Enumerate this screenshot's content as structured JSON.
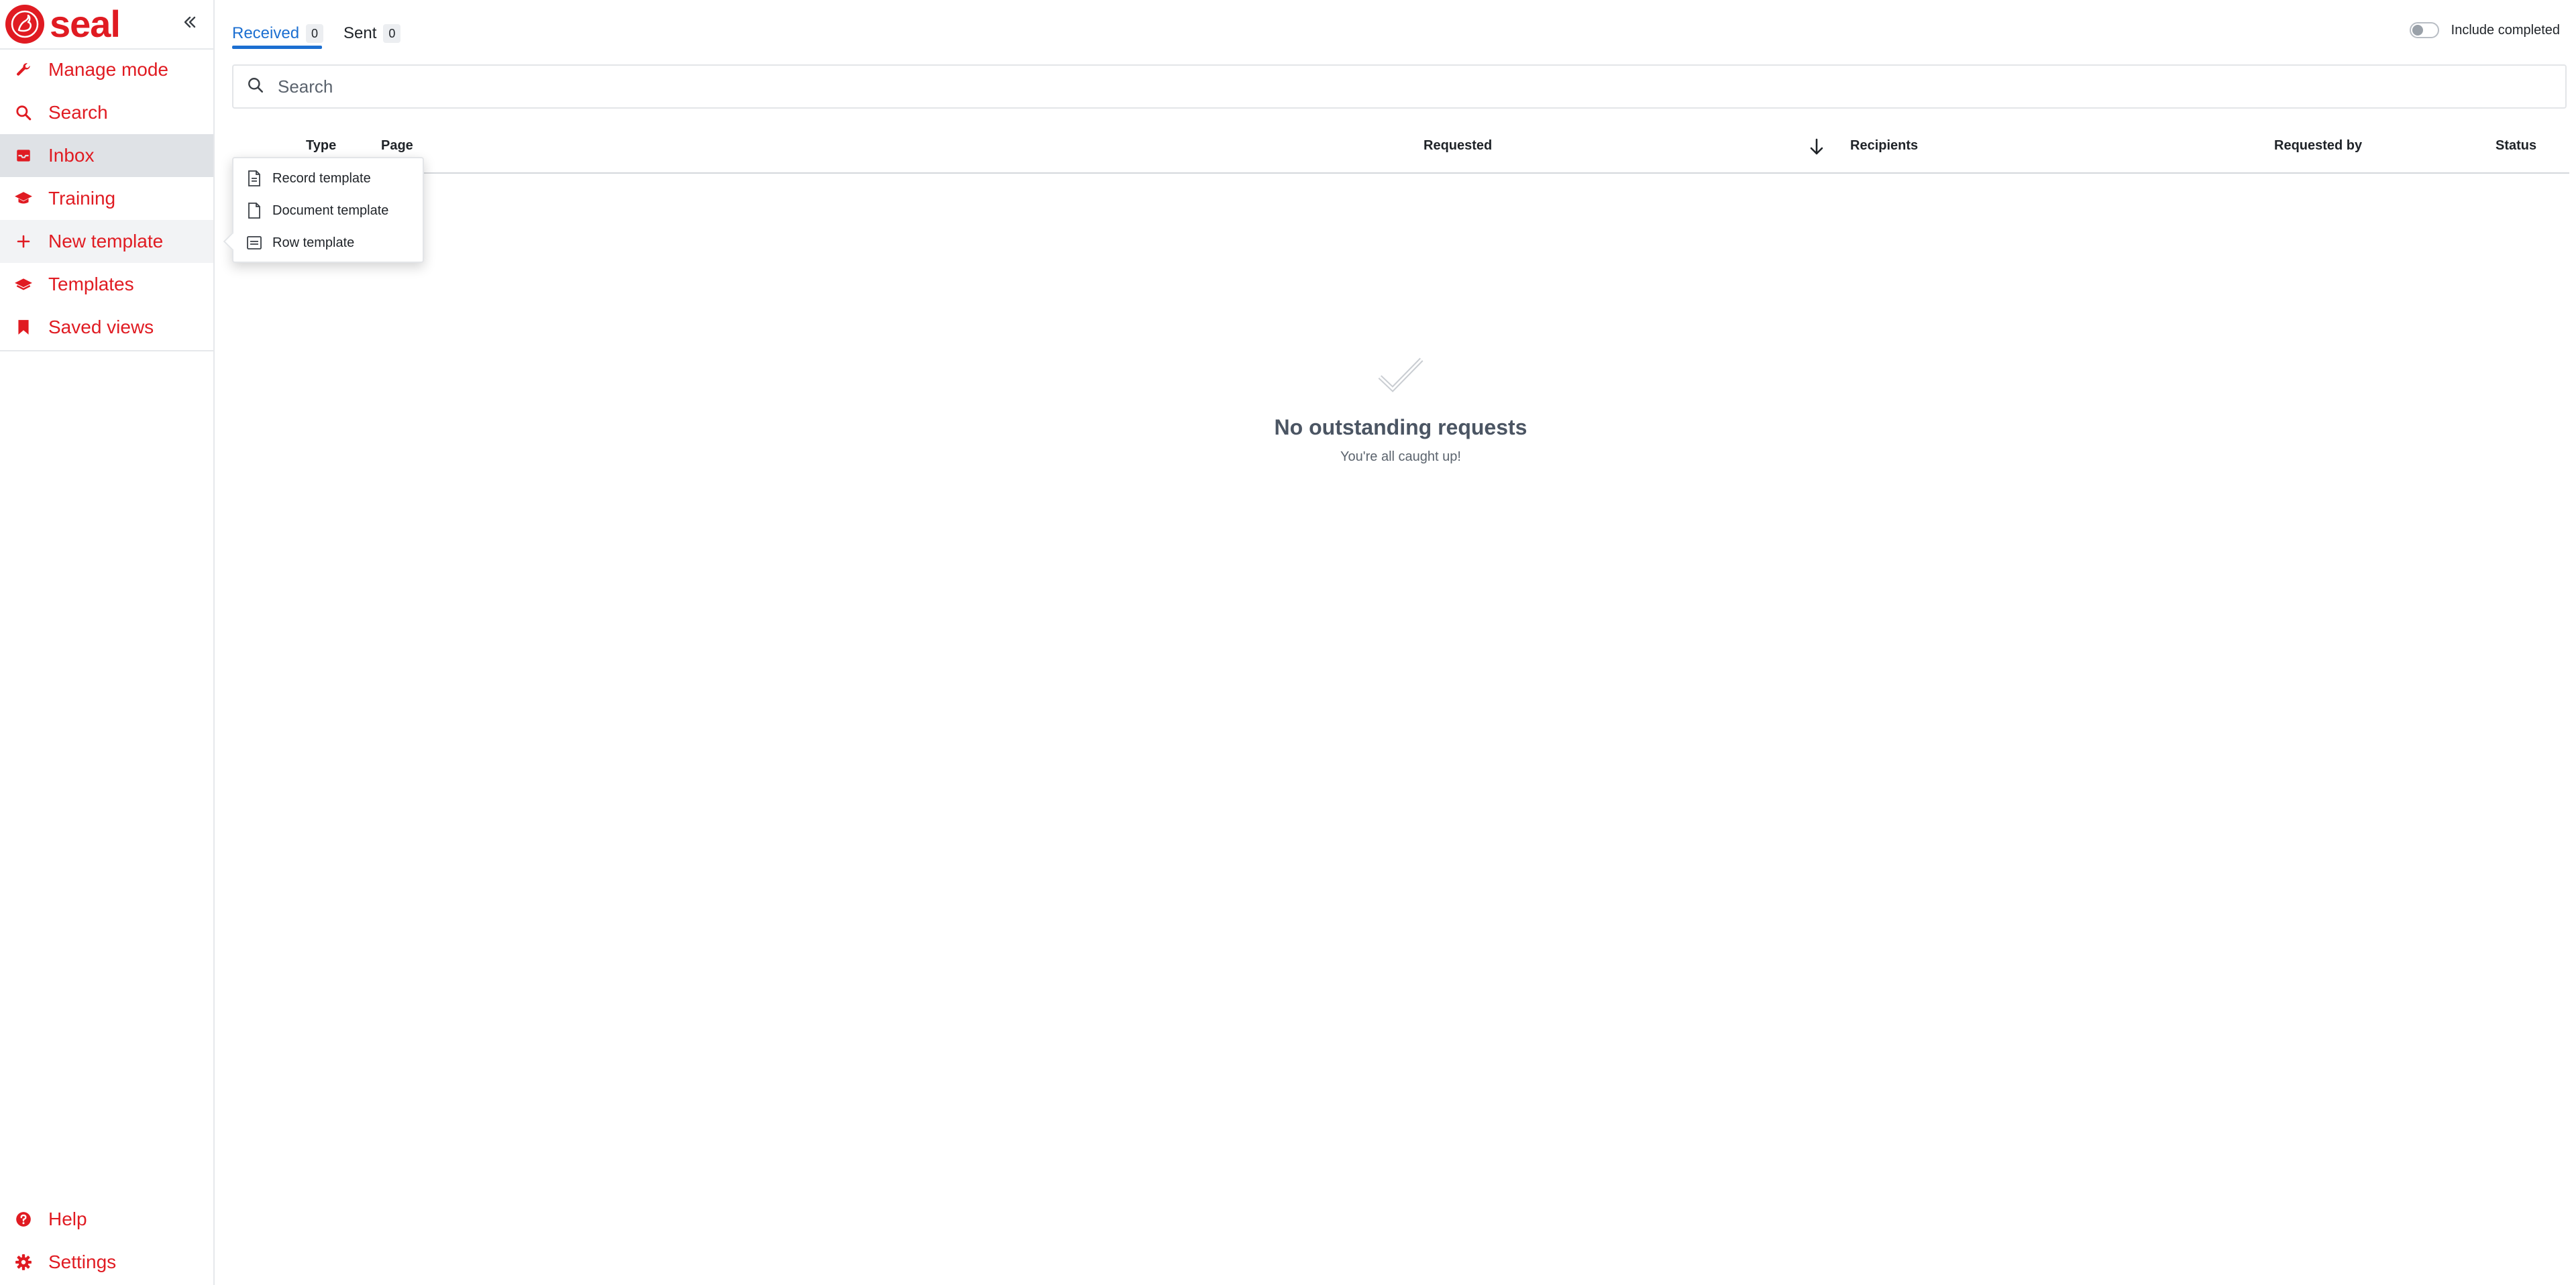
{
  "brand": {
    "name": "seal"
  },
  "sidebar": {
    "collapse_icon": "double-chevron-left-icon",
    "accent_color": "#e01b22",
    "items": [
      {
        "label": "Manage mode",
        "icon": "wrench-icon"
      },
      {
        "label": "Search",
        "icon": "search-icon"
      },
      {
        "label": "Inbox",
        "icon": "inbox-icon",
        "active": true
      },
      {
        "label": "Training",
        "icon": "graduation-cap-icon"
      },
      {
        "label": "New template",
        "icon": "plus-icon",
        "hovered": true
      },
      {
        "label": "Templates",
        "icon": "layers-icon"
      },
      {
        "label": "Saved views",
        "icon": "bookmark-icon"
      }
    ],
    "bottom_items": [
      {
        "label": "Help",
        "icon": "help-circle-icon"
      },
      {
        "label": "Settings",
        "icon": "gear-icon"
      }
    ]
  },
  "tabs": [
    {
      "label": "Received",
      "count": "0",
      "active": true
    },
    {
      "label": "Sent",
      "count": "0",
      "active": false
    }
  ],
  "include_completed": {
    "label": "Include completed",
    "checked": false
  },
  "search": {
    "placeholder": "Search",
    "value": ""
  },
  "table": {
    "columns": [
      "Type",
      "Page",
      "Requested",
      "Recipients",
      "Requested by",
      "Status"
    ],
    "sort_column": "Requested",
    "sort_direction": "descending"
  },
  "empty_state": {
    "icon": "checkmark-icon",
    "title": "No outstanding requests",
    "subtitle": "You're all caught up!"
  },
  "new_template_menu": {
    "items": [
      {
        "label": "Record template",
        "icon": "record-file-icon"
      },
      {
        "label": "Document template",
        "icon": "document-icon"
      },
      {
        "label": "Row template",
        "icon": "row-icon"
      }
    ]
  },
  "colors": {
    "accent_red": "#e01b22",
    "tab_blue": "#1c6fd1",
    "active_nav_bg": "#dfe2e6"
  }
}
